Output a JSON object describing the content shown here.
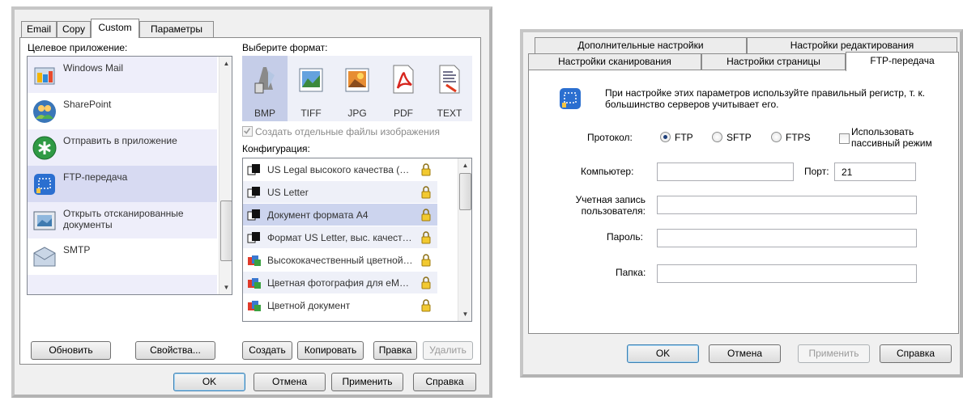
{
  "left_dialog": {
    "tabs": [
      "Email",
      "Copy",
      "Custom",
      "Параметры"
    ],
    "active_tab": "Custom",
    "target_app_label": "Целевое приложение:",
    "apps": [
      {
        "name": "Windows Mail",
        "icon": "windows-mail-icon"
      },
      {
        "name": "SharePoint",
        "icon": "sharepoint-icon"
      },
      {
        "name": "Отправить в приложение",
        "icon": "send-to-app-icon"
      },
      {
        "name": "FTP-передача",
        "icon": "ftp-transfer-icon",
        "selected": true
      },
      {
        "name": "Открыть отсканированные документы",
        "icon": "open-scanned-docs-icon"
      },
      {
        "name": "SMTP",
        "icon": "smtp-envelope-icon"
      }
    ],
    "format_label": "Выберите формат:",
    "formats": [
      {
        "name": "BMP",
        "icon": "bmp-icon",
        "selected": true
      },
      {
        "name": "TIFF",
        "icon": "tiff-icon"
      },
      {
        "name": "JPG",
        "icon": "jpg-icon"
      },
      {
        "name": "PDF",
        "icon": "pdf-icon"
      },
      {
        "name": "TEXT",
        "icon": "text-icon"
      }
    ],
    "separate_files_label": "Создать отдельные файлы изображения",
    "separate_files_checked": true,
    "config_label": "Конфигурация:",
    "configs": [
      {
        "name": "US Legal высокого качества (дуп...",
        "icon": "bw-doc-icon"
      },
      {
        "name": "US Letter",
        "icon": "bw-doc-icon"
      },
      {
        "name": "Документ формата A4",
        "icon": "bw-doc-icon",
        "selected": true
      },
      {
        "name": "Формат US Letter, выс. качество...",
        "icon": "bw-doc-icon"
      },
      {
        "name": "Высококачественный цветной д...",
        "icon": "color-doc-icon"
      },
      {
        "name": "Цветная фотография для eMail (6...",
        "icon": "color-doc-icon"
      },
      {
        "name": "Цветной документ",
        "icon": "color-doc-icon"
      }
    ],
    "buttons": {
      "refresh": "Обновить",
      "properties": "Свойства...",
      "create": "Создать",
      "copy": "Копировать",
      "edit": "Правка",
      "delete": "Удалить",
      "ok": "OK",
      "cancel": "Отмена",
      "apply": "Применить",
      "help": "Справка"
    }
  },
  "right_dialog": {
    "tabs_row1": [
      "Дополнительные настройки",
      "Настройки редактирования"
    ],
    "tabs_row2": [
      "Настройки сканирования",
      "Настройки страницы",
      "FTP-передача"
    ],
    "active_tab": "FTP-передача",
    "info_text": "При настройке этих параметров используйте правильный регистр, т. к. большинство серверов учитывает его.",
    "protocol_label": "Протокол:",
    "protocols": [
      "FTP",
      "SFTP",
      "FTPS"
    ],
    "protocol_selected": "FTP",
    "passive_mode_label": "Использовать пассивный режим",
    "passive_mode_checked": false,
    "computer_label": "Компьютер:",
    "computer_value": "",
    "port_label": "Порт:",
    "port_value": "21",
    "user_account_label": "Учетная запись пользователя:",
    "user_account_value": "",
    "password_label": "Пароль:",
    "password_value": "",
    "folder_label": "Папка:",
    "folder_value": "",
    "buttons": {
      "ok": "OK",
      "cancel": "Отмена",
      "apply": "Применить",
      "help": "Справка"
    }
  }
}
